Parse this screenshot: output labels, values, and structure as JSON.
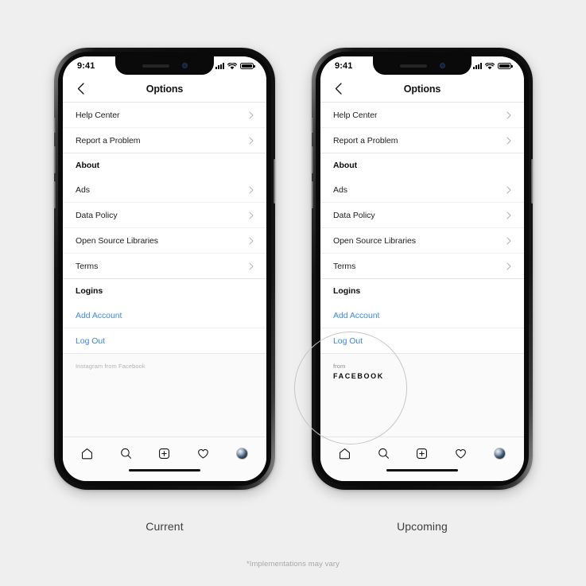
{
  "page": {
    "background_color": "#efefef",
    "disclaimer": "*Implementations may vary"
  },
  "captions": {
    "left": "Current",
    "right": "Upcoming"
  },
  "status_bar": {
    "time": "9:41",
    "signal_icon": "cellular-signal-icon",
    "wifi_icon": "wifi-icon",
    "battery_icon": "battery-full-icon"
  },
  "nav_header": {
    "back_icon": "chevron-left-icon",
    "title": "Options"
  },
  "list": {
    "sections": [
      {
        "rows": [
          {
            "label": "Help Center",
            "type": "nav",
            "chevron": true
          },
          {
            "label": "Report a Problem",
            "type": "nav",
            "chevron": true
          }
        ]
      },
      {
        "rows": [
          {
            "label": "About",
            "type": "header",
            "chevron": false
          },
          {
            "label": "Ads",
            "type": "nav",
            "chevron": true
          },
          {
            "label": "Data Policy",
            "type": "nav",
            "chevron": true
          },
          {
            "label": "Open Source Libraries",
            "type": "nav",
            "chevron": true
          },
          {
            "label": "Terms",
            "type": "nav",
            "chevron": true
          }
        ]
      },
      {
        "rows": [
          {
            "label": "Logins",
            "type": "header",
            "chevron": false
          },
          {
            "label": "Add Account",
            "type": "link",
            "chevron": false
          },
          {
            "label": "Log Out",
            "type": "link",
            "chevron": false
          }
        ]
      }
    ],
    "link_color": "#3f87e8"
  },
  "branding": {
    "current": "Instagram from Facebook",
    "upcoming_from": "from",
    "upcoming_name": "FACEBOOK"
  },
  "tab_bar": {
    "items": [
      {
        "icon": "home-icon"
      },
      {
        "icon": "search-icon"
      },
      {
        "icon": "add-post-icon"
      },
      {
        "icon": "heart-activity-icon"
      },
      {
        "icon": "profile-avatar-icon"
      }
    ]
  },
  "annotation": {
    "spotlight_icon": "highlight-circle"
  }
}
